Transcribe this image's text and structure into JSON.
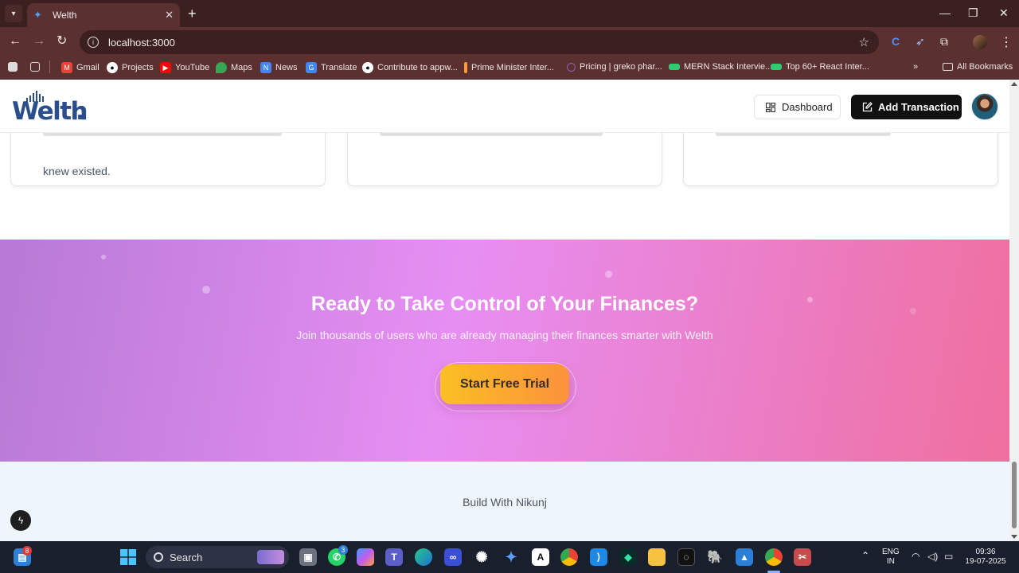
{
  "browser": {
    "tab_title": "Welth",
    "url": "localhost:3000"
  },
  "bookmarks": [
    {
      "label": "Gmail",
      "color": "#ea4335",
      "icon": "gmail-icon"
    },
    {
      "label": "Projects",
      "color": "#ffffff",
      "icon": "github-icon"
    },
    {
      "label": "YouTube",
      "color": "#ff0000",
      "icon": "youtube-icon"
    },
    {
      "label": "Maps",
      "color": "#34a853",
      "icon": "maps-icon"
    },
    {
      "label": "News",
      "color": "#4285f4",
      "icon": "news-icon"
    },
    {
      "label": "Translate",
      "color": "#4285f4",
      "icon": "translate-icon"
    },
    {
      "label": "Contribute to appw...",
      "color": "#ffffff",
      "icon": "github-icon"
    },
    {
      "label": "Prime Minister Inter...",
      "color": "#ff9933",
      "icon": "bookmark-icon"
    },
    {
      "label": "Pricing | greko phar...",
      "color": "#9b59b6",
      "icon": "bookmark-icon"
    },
    {
      "label": "MERN Stack Intervie...",
      "color": "#2ecc71",
      "icon": "bookmark-icon"
    },
    {
      "label": "Top 60+ React Inter...",
      "color": "#2ecc71",
      "icon": "bookmark-icon"
    }
  ],
  "all_bookmarks": "All Bookmarks",
  "site": {
    "logo": "Welth",
    "dashboard_label": "Dashboard",
    "add_transaction_label": "Add Transaction",
    "cards": [
      {
        "text": "knew existed."
      },
      {
        "text": ""
      },
      {
        "text": ""
      }
    ],
    "cta": {
      "title": "Ready to Take Control of Your Finances?",
      "subtitle": "Join thousands of users who are already managing their finances smarter with Welth",
      "button": "Start Free Trial"
    },
    "footer": "Build With Nikunj"
  },
  "taskbar": {
    "search_label": "Search",
    "notification_count": "8",
    "whatsapp_badge": "3",
    "language": "ENG",
    "region": "IN",
    "time": "09:36",
    "date": "19-07-2025"
  },
  "colors": {
    "brand": "#2a4e8c",
    "cta_start": "#b77ad6",
    "cta_mid": "#e78ef3",
    "cta_end": "#ef6f9e",
    "trial_start": "#fbbf24",
    "trial_end": "#fb923c"
  }
}
